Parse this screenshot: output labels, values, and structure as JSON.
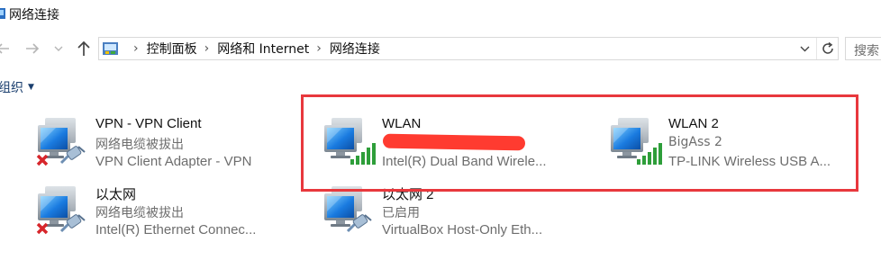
{
  "window": {
    "title": "网络连接"
  },
  "nav": {
    "back_icon": "back-arrow-icon",
    "forward_icon": "forward-arrow-icon",
    "recent_icon": "chevron-down-icon",
    "up_icon": "up-arrow-icon"
  },
  "address": {
    "crumbs": [
      "控制面板",
      "网络和 Internet",
      "网络连接"
    ],
    "separator": "›",
    "dropdown": "⌄"
  },
  "search": {
    "placeholder": "搜索"
  },
  "toolbar": {
    "organize_label": "组织"
  },
  "connections": [
    {
      "name": "VPN - VPN Client",
      "status": "网络电缆被拔出",
      "adapter": "VPN Client Adapter - VPN",
      "type": "wired",
      "disconnected": true
    },
    {
      "name": "WLAN",
      "status": "",
      "adapter": "Intel(R) Dual Band Wirele...",
      "type": "wireless",
      "disconnected": false,
      "status_redacted": true
    },
    {
      "name": "WLAN 2",
      "status": "BigAss 2",
      "adapter": "TP-LINK Wireless USB A...",
      "type": "wireless",
      "disconnected": false
    },
    {
      "name": "以太网",
      "status": "网络电缆被拔出",
      "adapter": "Intel(R) Ethernet Connec...",
      "type": "wired",
      "disconnected": true
    },
    {
      "name": "以太网 2",
      "status": "已启用",
      "adapter": "VirtualBox Host-Only Eth...",
      "type": "wired",
      "disconnected": false
    }
  ],
  "colors": {
    "highlight": "#e8383d",
    "redaction": "#ff3b30",
    "monitor_blue": "#1a7be0",
    "signal_green": "#2e9e3a",
    "error_red": "#d7262b"
  }
}
